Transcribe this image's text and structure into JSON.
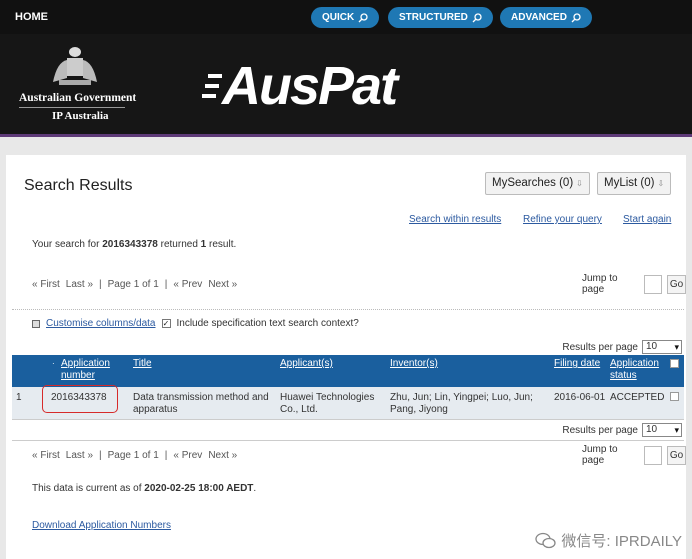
{
  "nav": {
    "home": "HOME",
    "quick": "QUICK",
    "structured": "STRUCTURED",
    "advanced": "ADVANCED"
  },
  "header": {
    "gov_line1": "Australian Government",
    "gov_line2": "IP Australia",
    "logo": "AusPat",
    "colors": {
      "nav_button": "#1f78b4",
      "header_bg": "#161616",
      "accent_line": "#5e3a78"
    }
  },
  "results": {
    "title": "Search Results",
    "mysearches": "MySearches (0)",
    "mylist": "MyList (0)",
    "search_within": "Search within results",
    "refine": "Refine your query",
    "start_again": "Start again",
    "summary_prefix": "Your search for ",
    "query": "2016343378",
    "summary_mid": " returned ",
    "count": "1",
    "summary_suffix": " result."
  },
  "pager": {
    "first": "« First",
    "last": "Last »",
    "sep1": "|",
    "page": "Page 1 of 1",
    "sep2": "|",
    "prev": "« Prev",
    "next": "Next »",
    "jump_label": "Jump to page",
    "go": "Go"
  },
  "options": {
    "customise": "Customise columns/data",
    "include_spec": "Include specification text search context?",
    "rpp_label": "Results per page",
    "rpp_value": "10"
  },
  "table": {
    "headers": {
      "app_number": "Application number",
      "title": "Title",
      "applicant": "Applicant(s)",
      "inventor": "Inventor(s)",
      "filing_date": "Filing date",
      "status": "Application status"
    },
    "rows": [
      {
        "index": "1",
        "app_number": "2016343378",
        "title": "Data transmission method and apparatus",
        "applicant": "Huawei Technologies Co., Ltd.",
        "inventor": "Zhu, Jun; Lin, Yingpei; Luo, Jun; Pang, Jiyong",
        "filing_date": "2016-06-01",
        "status": "ACCEPTED"
      }
    ]
  },
  "footer": {
    "current_prefix": "This data is current as of ",
    "current_date": "2020-02-25 18:00 AEDT",
    "current_suffix": ".",
    "download": "Download Application Numbers"
  },
  "watermark": "微信号: IPRDAILY"
}
